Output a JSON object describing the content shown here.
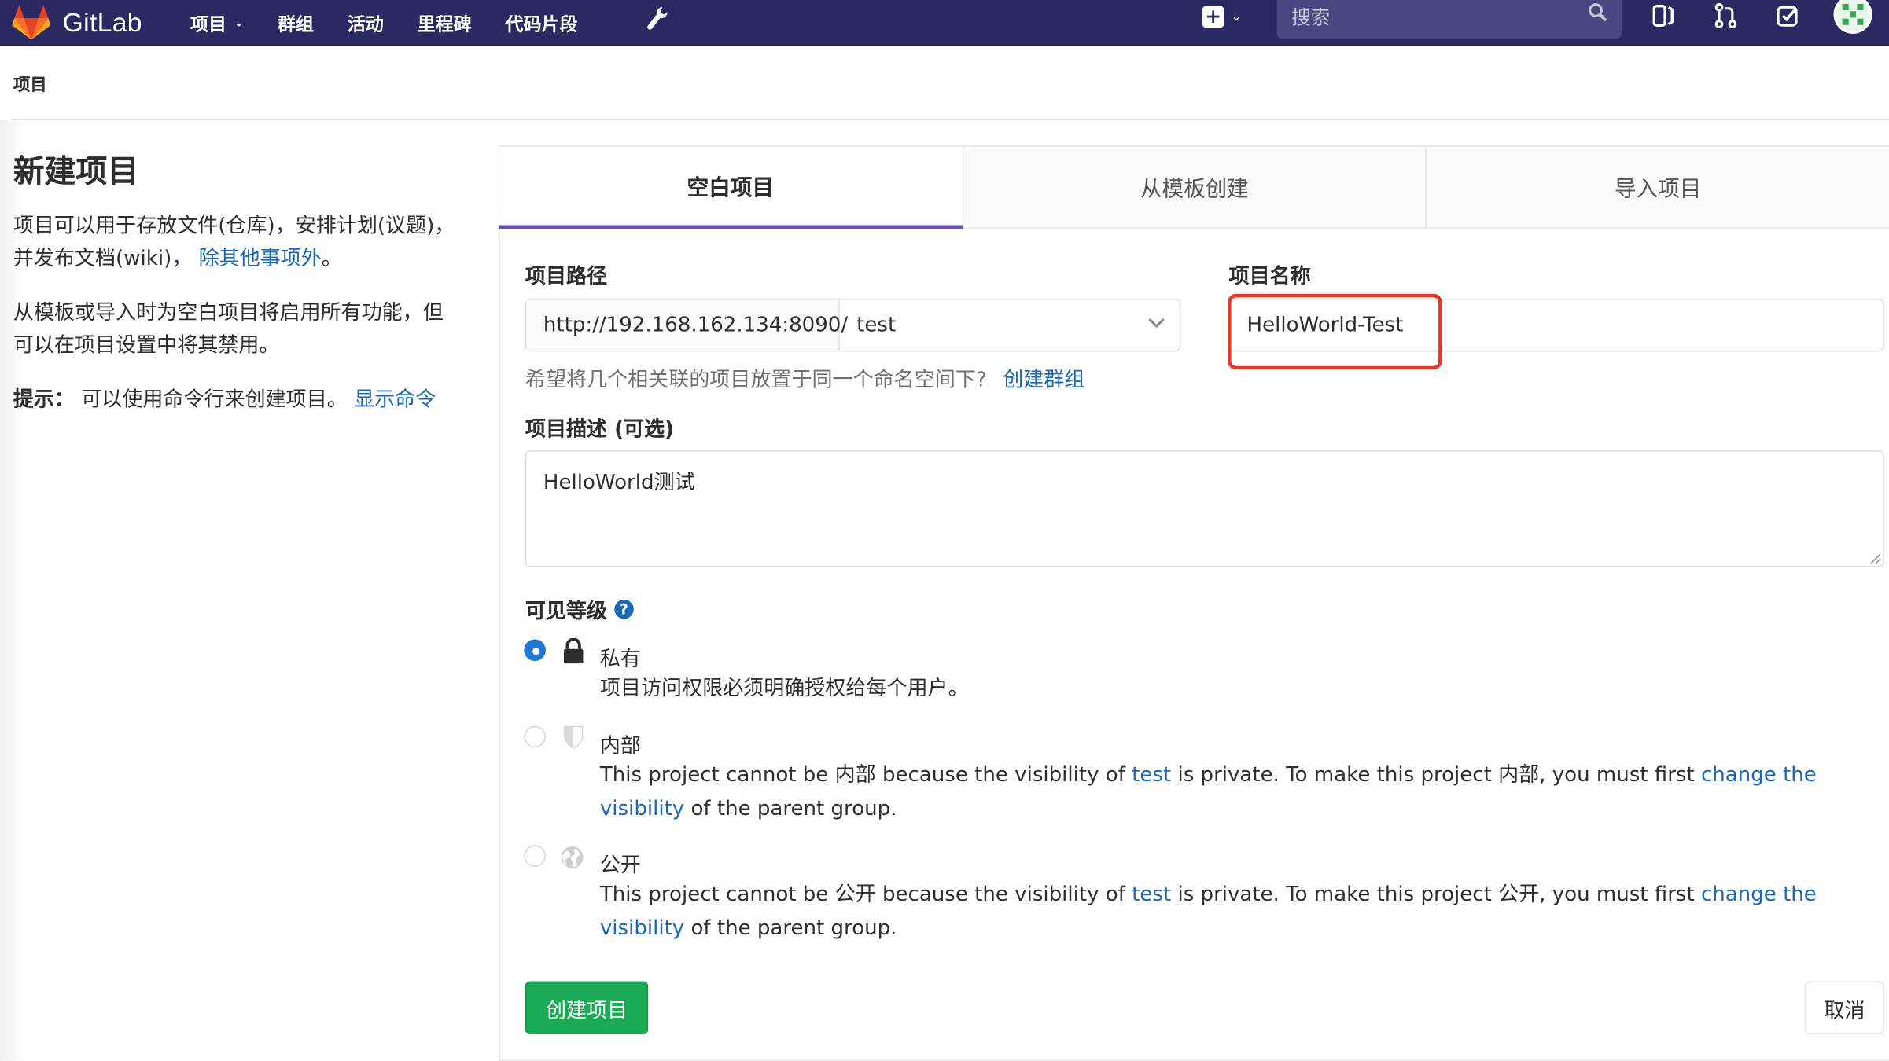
{
  "app": {
    "name": "GitLab"
  },
  "nav": {
    "items": [
      {
        "label": "项目",
        "has_dropdown": true
      },
      {
        "label": "群组",
        "has_dropdown": false
      },
      {
        "label": "活动",
        "has_dropdown": false
      },
      {
        "label": "里程碑",
        "has_dropdown": false
      },
      {
        "label": "代码片段",
        "has_dropdown": false
      }
    ],
    "search_placeholder": "搜索"
  },
  "breadcrumb": "项目",
  "left": {
    "title": "新建项目",
    "para1_text": "项目可以用于存放文件(仓库)，安排计划(议题)，并发布文档(wiki)，",
    "para1_link": "除其他事项外",
    "para1_end": "。",
    "para2": "从模板或导入时为空白项目将启用所有功能，但可以在项目设置中将其禁用。",
    "tip_label": "提示：",
    "tip_text": "可以使用命令行来创建项目。",
    "tip_link": "显示命令"
  },
  "tabs": [
    {
      "label": "空白项目",
      "active": true
    },
    {
      "label": "从模板创建",
      "active": false
    },
    {
      "label": "导入项目",
      "active": false
    }
  ],
  "form": {
    "path_label": "项目路径",
    "path_prefix": "http://192.168.162.134:8090/",
    "path_namespace": "test",
    "name_label": "项目名称",
    "name_value": "HelloWorld-Test",
    "hint_text": "希望将几个相关联的项目放置于同一个命名空间下?",
    "hint_link": "创建群组",
    "desc_label": "项目描述 (可选)",
    "desc_value": "HelloWorld测试",
    "visibility_label": "可见等级",
    "visibility": [
      {
        "name": "私有",
        "checked": true,
        "icon": "lock-icon",
        "desc": "项目访问权限必须明确授权给每个用户。"
      },
      {
        "name": "内部",
        "checked": false,
        "icon": "shield-icon",
        "desc_a": "This project cannot be 内部 because the visibility of ",
        "desc_link1": "test",
        "desc_b": " is private. To make this project 内部, you must first ",
        "desc_link2": "change the visibility",
        "desc_c": " of the parent group."
      },
      {
        "name": "公开",
        "checked": false,
        "icon": "globe-icon",
        "desc_a": "This project cannot be 公开 because the visibility of ",
        "desc_link1": "test",
        "desc_b": " is private. To make this project 公开, you must first ",
        "desc_link2": "change the visibility",
        "desc_c": " of the parent group."
      }
    ],
    "create_button": "创建项目",
    "cancel_button": "取消"
  },
  "colors": {
    "navbar": "#2b2862",
    "link": "#1b69b6",
    "create": "#1aaa55",
    "highlight": "#e53a2a",
    "active_tab": "#6b4fbb"
  }
}
